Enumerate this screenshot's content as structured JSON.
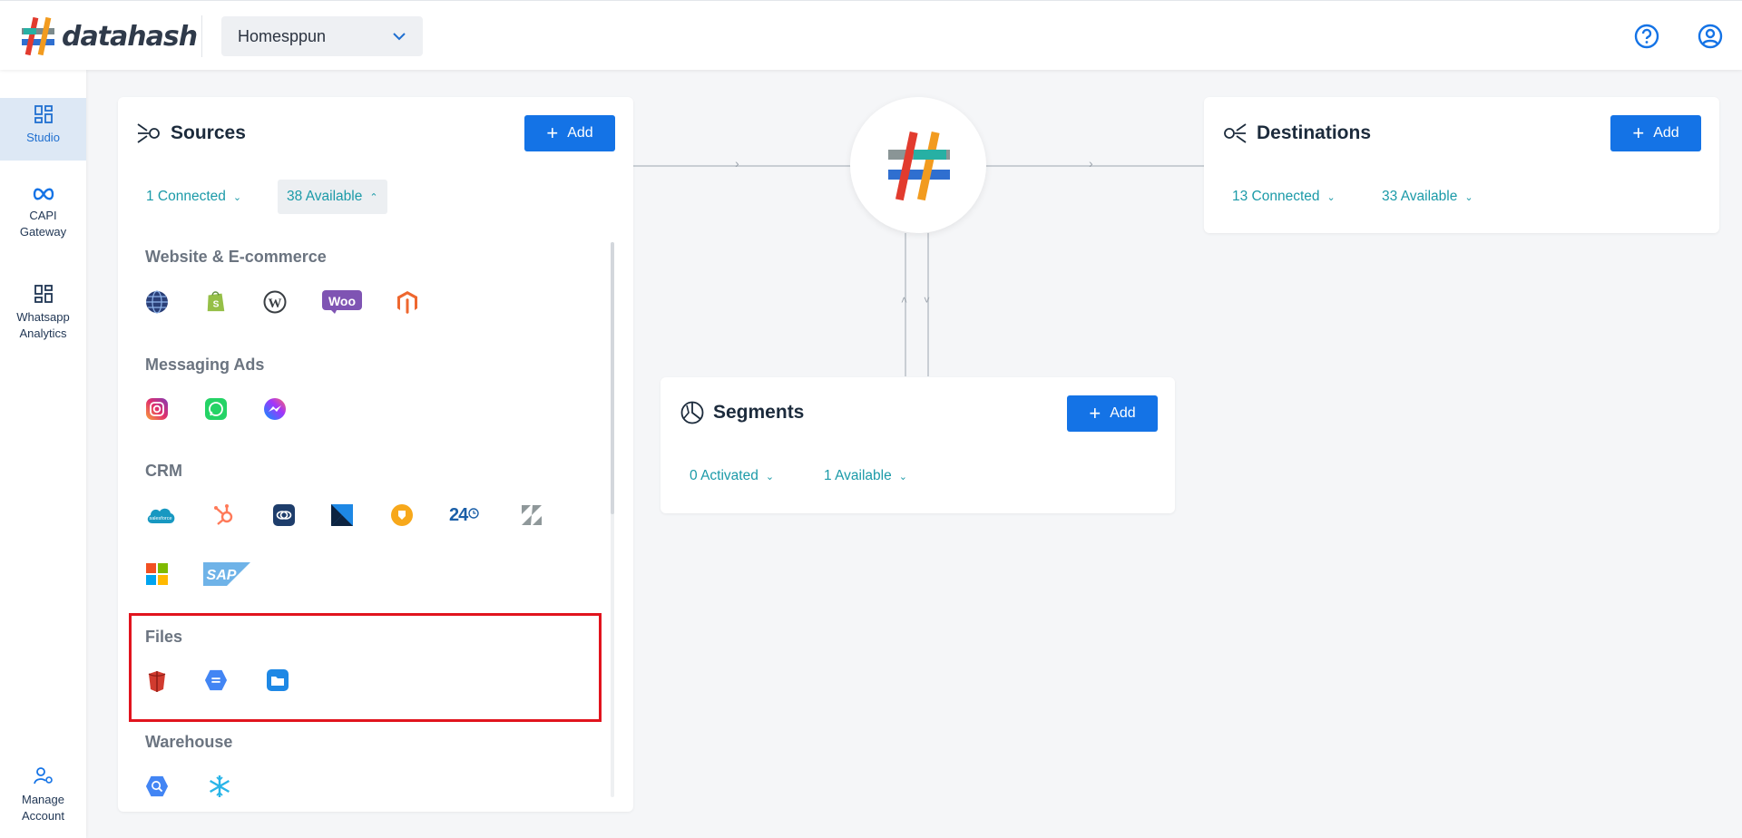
{
  "brand": {
    "name": "datahash"
  },
  "header": {
    "project": "Homesppun",
    "help_icon": "question-circle-icon",
    "account_icon": "user-circle-icon"
  },
  "sidebar": {
    "items": [
      {
        "label": "Studio",
        "icon": "dashboard-grid-icon",
        "active": true
      },
      {
        "label": "CAPI Gateway",
        "icon": "meta-infinity-icon"
      },
      {
        "label": "Whatsapp Analytics",
        "icon": "dashboard-grid-icon"
      }
    ],
    "bottom": {
      "label": "Manage Account",
      "icon": "user-settings-icon"
    }
  },
  "sources": {
    "title": "Sources",
    "add_label": "Add",
    "connected": "1 Connected",
    "available": "38 Available",
    "sections": {
      "website": "Website & E-commerce",
      "messaging": "Messaging Ads",
      "crm": "CRM",
      "files": "Files",
      "warehouse": "Warehouse"
    },
    "crm_24_label": "24"
  },
  "segments": {
    "title": "Segments",
    "add_label": "Add",
    "activated": "0 Activated",
    "available": "1 Available"
  },
  "destinations": {
    "title": "Destinations",
    "add_label": "Add",
    "connected": "13 Connected",
    "available": "33 Available"
  },
  "colors": {
    "primary": "#1473e6",
    "teal_text": "#1b9aa8",
    "highlight": "#e1141e",
    "sidebar_active_bg": "#dde8f5"
  }
}
